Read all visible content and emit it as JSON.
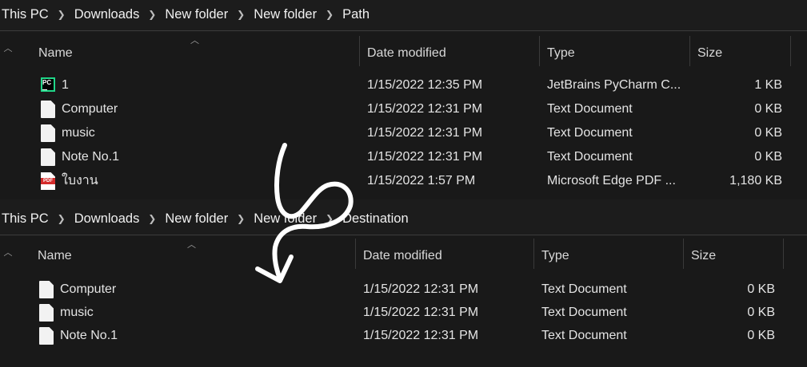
{
  "top": {
    "breadcrumb": [
      "This PC",
      "Downloads",
      "New folder",
      "New folder",
      "Path"
    ],
    "columns": {
      "name": "Name",
      "date": "Date modified",
      "type": "Type",
      "size": "Size"
    },
    "files": [
      {
        "name": "1",
        "date": "1/15/2022 12:35 PM",
        "type": "JetBrains PyCharm C...",
        "size": "1 KB",
        "icon": "pycharm-icon"
      },
      {
        "name": "Computer",
        "date": "1/15/2022 12:31 PM",
        "type": "Text Document",
        "size": "0 KB",
        "icon": "text-document-icon"
      },
      {
        "name": "music",
        "date": "1/15/2022 12:31 PM",
        "type": "Text Document",
        "size": "0 KB",
        "icon": "text-document-icon"
      },
      {
        "name": "Note No.1",
        "date": "1/15/2022 12:31 PM",
        "type": "Text Document",
        "size": "0 KB",
        "icon": "text-document-icon"
      },
      {
        "name": "ใบงาน",
        "date": "1/15/2022 1:57 PM",
        "type": "Microsoft Edge PDF ...",
        "size": "1,180 KB",
        "icon": "pdf-icon"
      }
    ]
  },
  "bottom": {
    "breadcrumb": [
      "This PC",
      "Downloads",
      "New folder",
      "New folder",
      "Destination"
    ],
    "columns": {
      "name": "Name",
      "date": "Date modified",
      "type": "Type",
      "size": "Size"
    },
    "files": [
      {
        "name": "Computer",
        "date": "1/15/2022 12:31 PM",
        "type": "Text Document",
        "size": "0 KB",
        "icon": "text-document-icon"
      },
      {
        "name": "music",
        "date": "1/15/2022 12:31 PM",
        "type": "Text Document",
        "size": "0 KB",
        "icon": "text-document-icon"
      },
      {
        "name": "Note No.1",
        "date": "1/15/2022 12:31 PM",
        "type": "Text Document",
        "size": "0 KB",
        "icon": "text-document-icon"
      }
    ]
  },
  "icons": {
    "chevron": "chevron-right-icon",
    "sort": "sort-caret-up-icon",
    "scroll": "scroll-up-icon",
    "overlay": "curved-arrow-icon"
  },
  "colors": {
    "background": "#1c1c1c",
    "list_background": "#191919",
    "divider": "#3a3a3a",
    "pycharm": "#21d789",
    "pdf": "#d42b2b"
  }
}
